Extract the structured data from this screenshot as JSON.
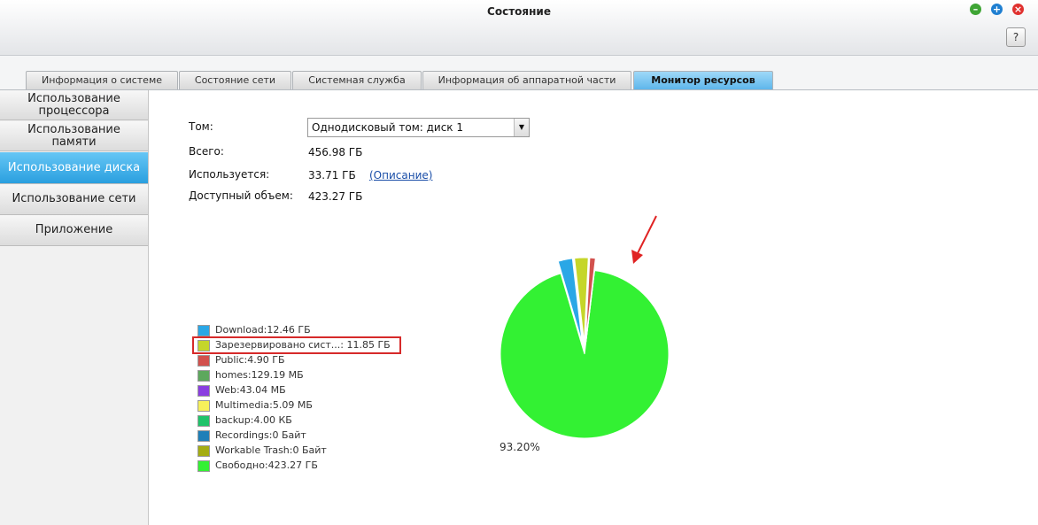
{
  "window": {
    "title": "Состояние",
    "help_label": "?"
  },
  "colors": {
    "minimize": "#3fa535",
    "maximize": "#1f7fd1",
    "close": "#e0312f",
    "accent": "#2a9fdf"
  },
  "tabs": [
    {
      "label": "Информация о системе",
      "active": false
    },
    {
      "label": "Состояние сети",
      "active": false
    },
    {
      "label": "Системная служба",
      "active": false
    },
    {
      "label": "Информация об аппаратной части",
      "active": false
    },
    {
      "label": "Монитор ресурсов",
      "active": true
    }
  ],
  "sidebar": {
    "items": [
      {
        "label": "Использование процессора",
        "active": false
      },
      {
        "label": "Использование памяти",
        "active": false
      },
      {
        "label": "Использование диска",
        "active": true
      },
      {
        "label": "Использование сети",
        "active": false
      },
      {
        "label": "Приложение",
        "active": false
      }
    ]
  },
  "volume": {
    "label": "Том:",
    "selected": "Однодисковый том: диск  1",
    "total_label": "Всего:",
    "total_value": "456.98 ГБ",
    "used_label": "Используется:",
    "used_value": "33.71 ГБ",
    "description_link": "(Описание)",
    "free_label": "Доступный объем:",
    "free_value": "423.27 ГБ"
  },
  "chart_data": {
    "type": "pie",
    "slices": [
      {
        "label": "Download:12.46 ГБ",
        "value_gb": 12.46,
        "color": "#2aa7e6"
      },
      {
        "label": "Зарезервировано сист...: 11.85 ГБ",
        "value_gb": 11.85,
        "color": "#c5d62a"
      },
      {
        "label": "Public:4.90 ГБ",
        "value_gb": 4.9,
        "color": "#d2514d"
      },
      {
        "label": "homes:129.19 МБ",
        "value_gb": 0.126,
        "color": "#5da85d"
      },
      {
        "label": "Web:43.04 МБ",
        "value_gb": 0.042,
        "color": "#8a3ee0"
      },
      {
        "label": "Multimedia:5.09 МБ",
        "value_gb": 0.005,
        "color": "#f6f05a"
      },
      {
        "label": "backup:4.00 КБ",
        "value_gb": 0.0,
        "color": "#1fc36a"
      },
      {
        "label": "Recordings:0 Байт",
        "value_gb": 0,
        "color": "#1e7fb8"
      },
      {
        "label": "Workable Trash:0 Байт",
        "value_gb": 0,
        "color": "#a4ad12"
      },
      {
        "label": "Свободно:423.27 ГБ",
        "value_gb": 423.27,
        "color": "#33f133"
      }
    ],
    "annotation": "93.20%"
  }
}
